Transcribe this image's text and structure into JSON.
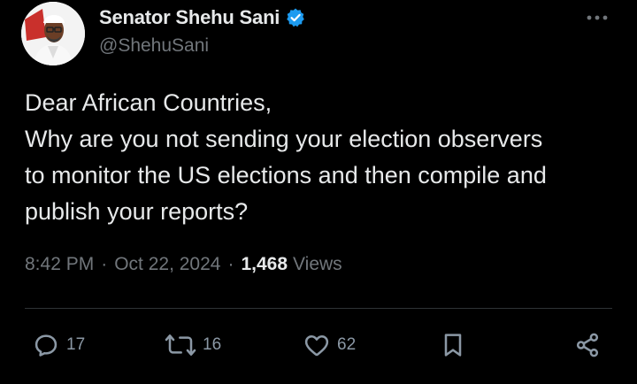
{
  "author": {
    "display_name": "Senator Shehu Sani",
    "handle": "@ShehuSani",
    "verified": true,
    "verified_color": "#1d9bf0"
  },
  "tweet": {
    "lines": [
      "Dear African Countries,",
      "Why are you not sending your election observers",
      "to monitor the US elections and then compile and",
      "publish your reports?"
    ],
    "time": "8:42 PM",
    "separator": "·",
    "date": "Oct 22, 2024",
    "views_count": "1,468",
    "views_label": "Views"
  },
  "actions": {
    "replies": "17",
    "reposts": "16",
    "likes": "62"
  },
  "icons": {
    "more": "more-horizontal-icon",
    "reply": "reply-icon",
    "repost": "repost-icon",
    "like": "heart-icon",
    "bookmark": "bookmark-icon",
    "share": "share-icon"
  },
  "colors": {
    "background": "#000000",
    "text": "#e7e9ea",
    "secondary": "#71767b",
    "icon": "#8b98a5"
  }
}
